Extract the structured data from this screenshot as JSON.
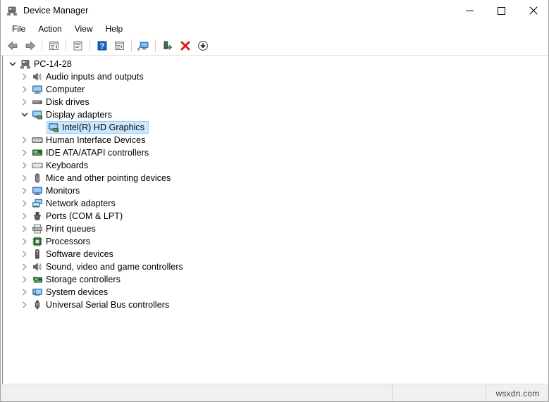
{
  "window": {
    "title": "Device Manager",
    "icon": "device-manager-icon",
    "controls": {
      "minimize": "—",
      "maximize": "☐",
      "close": "✕",
      "minimize_name": "minimize-button",
      "maximize_name": "maximize-button",
      "close_name": "close-button"
    }
  },
  "menubar": {
    "items": [
      {
        "label": "File",
        "name": "menu-file"
      },
      {
        "label": "Action",
        "name": "menu-action"
      },
      {
        "label": "View",
        "name": "menu-view"
      },
      {
        "label": "Help",
        "name": "menu-help"
      }
    ]
  },
  "toolbar": {
    "buttons": [
      {
        "name": "back-button",
        "icon": "back-arrow-icon",
        "tooltip": "Back"
      },
      {
        "name": "forward-button",
        "icon": "forward-arrow-icon",
        "tooltip": "Forward"
      },
      {
        "name": "separator-1",
        "icon": "separator",
        "tooltip": ""
      },
      {
        "name": "up-one-level-button",
        "icon": "up-level-icon",
        "tooltip": "Up one level"
      },
      {
        "name": "separator-2",
        "icon": "separator",
        "tooltip": ""
      },
      {
        "name": "properties-button",
        "icon": "properties-icon",
        "tooltip": "Properties"
      },
      {
        "name": "separator-3",
        "icon": "separator",
        "tooltip": ""
      },
      {
        "name": "help-button",
        "icon": "help-question-icon",
        "tooltip": "Help"
      },
      {
        "name": "show-hidden-button",
        "icon": "show-console-tree-icon",
        "tooltip": "Show/Hide"
      },
      {
        "name": "separator-4",
        "icon": "separator",
        "tooltip": ""
      },
      {
        "name": "scan-hardware-button",
        "icon": "scan-monitor-icon",
        "tooltip": "Scan for hardware changes"
      },
      {
        "name": "separator-5",
        "icon": "separator",
        "tooltip": ""
      },
      {
        "name": "update-driver-button",
        "icon": "update-driver-icon",
        "tooltip": "Update driver"
      },
      {
        "name": "uninstall-device-button",
        "icon": "red-x-icon",
        "tooltip": "Uninstall device"
      },
      {
        "name": "disable-device-button",
        "icon": "disable-down-arrow-icon",
        "tooltip": "Disable device"
      }
    ]
  },
  "tree": {
    "rows": [
      {
        "label": "PC-14-28",
        "depth": 0,
        "state": "expanded",
        "icon": "computer-root-icon",
        "selected": false
      },
      {
        "label": "Audio inputs and outputs",
        "depth": 1,
        "state": "collapsed",
        "icon": "speaker-icon",
        "selected": false
      },
      {
        "label": "Computer",
        "depth": 1,
        "state": "collapsed",
        "icon": "monitor-icon",
        "selected": false
      },
      {
        "label": "Disk drives",
        "depth": 1,
        "state": "collapsed",
        "icon": "disk-drive-icon",
        "selected": false
      },
      {
        "label": "Display adapters",
        "depth": 1,
        "state": "expanded",
        "icon": "display-adapter-icon",
        "selected": false
      },
      {
        "label": "Intel(R) HD Graphics",
        "depth": 2,
        "state": "leaf",
        "icon": "display-adapter-icon",
        "selected": true
      },
      {
        "label": "Human Interface Devices",
        "depth": 1,
        "state": "collapsed",
        "icon": "hid-icon",
        "selected": false
      },
      {
        "label": "IDE ATA/ATAPI controllers",
        "depth": 1,
        "state": "collapsed",
        "icon": "ide-controller-icon",
        "selected": false
      },
      {
        "label": "Keyboards",
        "depth": 1,
        "state": "collapsed",
        "icon": "keyboard-icon",
        "selected": false
      },
      {
        "label": "Mice and other pointing devices",
        "depth": 1,
        "state": "collapsed",
        "icon": "mouse-icon",
        "selected": false
      },
      {
        "label": "Monitors",
        "depth": 1,
        "state": "collapsed",
        "icon": "monitor-icon",
        "selected": false
      },
      {
        "label": "Network adapters",
        "depth": 1,
        "state": "collapsed",
        "icon": "network-adapter-icon",
        "selected": false
      },
      {
        "label": "Ports (COM & LPT)",
        "depth": 1,
        "state": "collapsed",
        "icon": "port-icon",
        "selected": false
      },
      {
        "label": "Print queues",
        "depth": 1,
        "state": "collapsed",
        "icon": "printer-icon",
        "selected": false
      },
      {
        "label": "Processors",
        "depth": 1,
        "state": "collapsed",
        "icon": "processor-icon",
        "selected": false
      },
      {
        "label": "Software devices",
        "depth": 1,
        "state": "collapsed",
        "icon": "software-device-icon",
        "selected": false
      },
      {
        "label": "Sound, video and game controllers",
        "depth": 1,
        "state": "collapsed",
        "icon": "speaker-icon",
        "selected": false
      },
      {
        "label": "Storage controllers",
        "depth": 1,
        "state": "collapsed",
        "icon": "storage-controller-icon",
        "selected": false
      },
      {
        "label": "System devices",
        "depth": 1,
        "state": "collapsed",
        "icon": "system-device-icon",
        "selected": false
      },
      {
        "label": "Universal Serial Bus controllers",
        "depth": 1,
        "state": "collapsed",
        "icon": "usb-icon",
        "selected": false
      }
    ]
  },
  "statusbar": {
    "main": "",
    "mid": "",
    "watermark": "wsxdn.com"
  },
  "colors": {
    "selection_fill": "#cce8ff",
    "selection_border": "#99d1ff",
    "window_bg": "#ffffff",
    "statusbar_bg": "#f0f0f0",
    "close_hover": "#e81123",
    "red_x": "#d81920",
    "green_accent": "#3a9a28",
    "blue_accent": "#1a63b8"
  }
}
